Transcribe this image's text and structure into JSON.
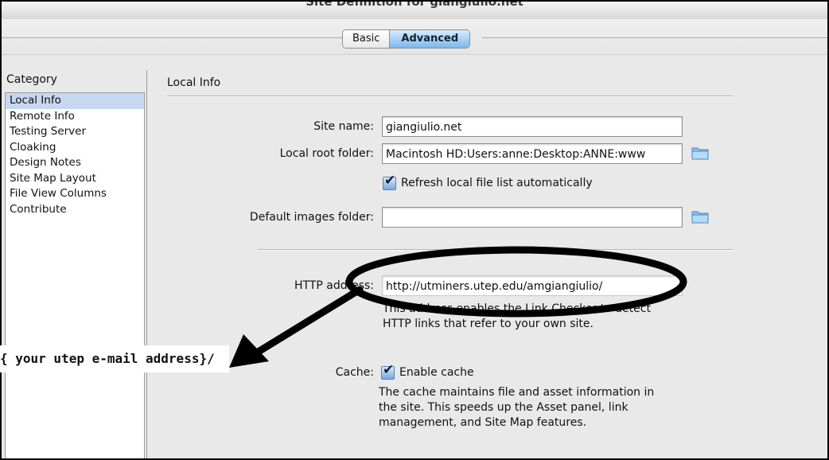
{
  "window": {
    "title": "Site Definition for giangiulio.net"
  },
  "tabs": [
    {
      "label": "Basic",
      "selected": false
    },
    {
      "label": "Advanced",
      "selected": true
    }
  ],
  "category": {
    "heading": "Category",
    "items": [
      "Local Info",
      "Remote Info",
      "Testing Server",
      "Cloaking",
      "Design Notes",
      "Site Map Layout",
      "File View Columns",
      "Contribute"
    ],
    "selected": "Local Info"
  },
  "section": {
    "title": "Local Info"
  },
  "fields": {
    "site_name": {
      "label": "Site name:",
      "value": "giangiulio.net"
    },
    "local_root": {
      "label": "Local root folder:",
      "value": "Macintosh HD:Users:anne:Desktop:ANNE:www"
    },
    "refresh": {
      "label": "Refresh local file list automatically",
      "checked": true
    },
    "default_images": {
      "label": "Default images folder:",
      "value": ""
    },
    "http_address": {
      "label": "HTTP address:",
      "value": "http://utminers.utep.edu/amgiangiulio/",
      "help_1": "This address enables the Link Checker to detect",
      "help_2": "HTTP links that refer to your own site."
    },
    "cache": {
      "label": "Cache:",
      "checkbox_label": "Enable cache",
      "checked": true,
      "help_1": "The cache maintains file and asset information in",
      "help_2": "the site.  This speeds up the Asset panel, link",
      "help_3": "management, and Site Map features."
    }
  },
  "annotation": {
    "callout_text": "{ your utep e-mail address}/",
    "highlight_color": "#000000"
  },
  "icons": {
    "folder": "folder-icon",
    "checkmark": "checkmark-icon"
  }
}
